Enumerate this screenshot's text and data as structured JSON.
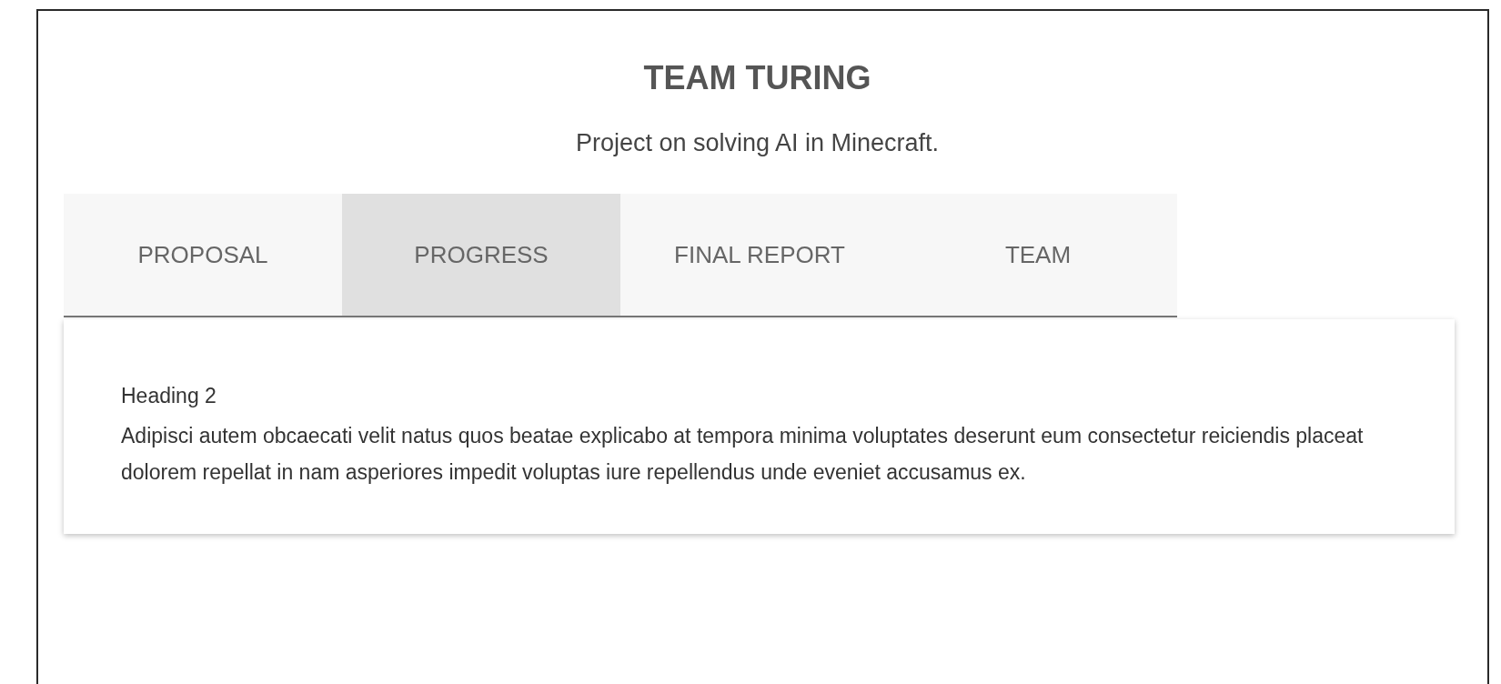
{
  "header": {
    "title": "TEAM TURING",
    "subtitle": "Project on solving AI in Minecraft."
  },
  "tabs": [
    {
      "label": "PROPOSAL",
      "selected": false
    },
    {
      "label": "PROGRESS",
      "selected": true
    },
    {
      "label": "FINAL REPORT",
      "selected": false
    },
    {
      "label": "TEAM",
      "selected": false
    }
  ],
  "content": {
    "heading": "Heading 2",
    "paragraph": "Adipisci autem obcaecati velit natus quos beatae explicabo at tempora minima voluptates deserunt eum consectetur reiciendis placeat dolorem repellat in nam asperiores impedit voluptas iure repellendus unde eveniet accusamus ex."
  }
}
